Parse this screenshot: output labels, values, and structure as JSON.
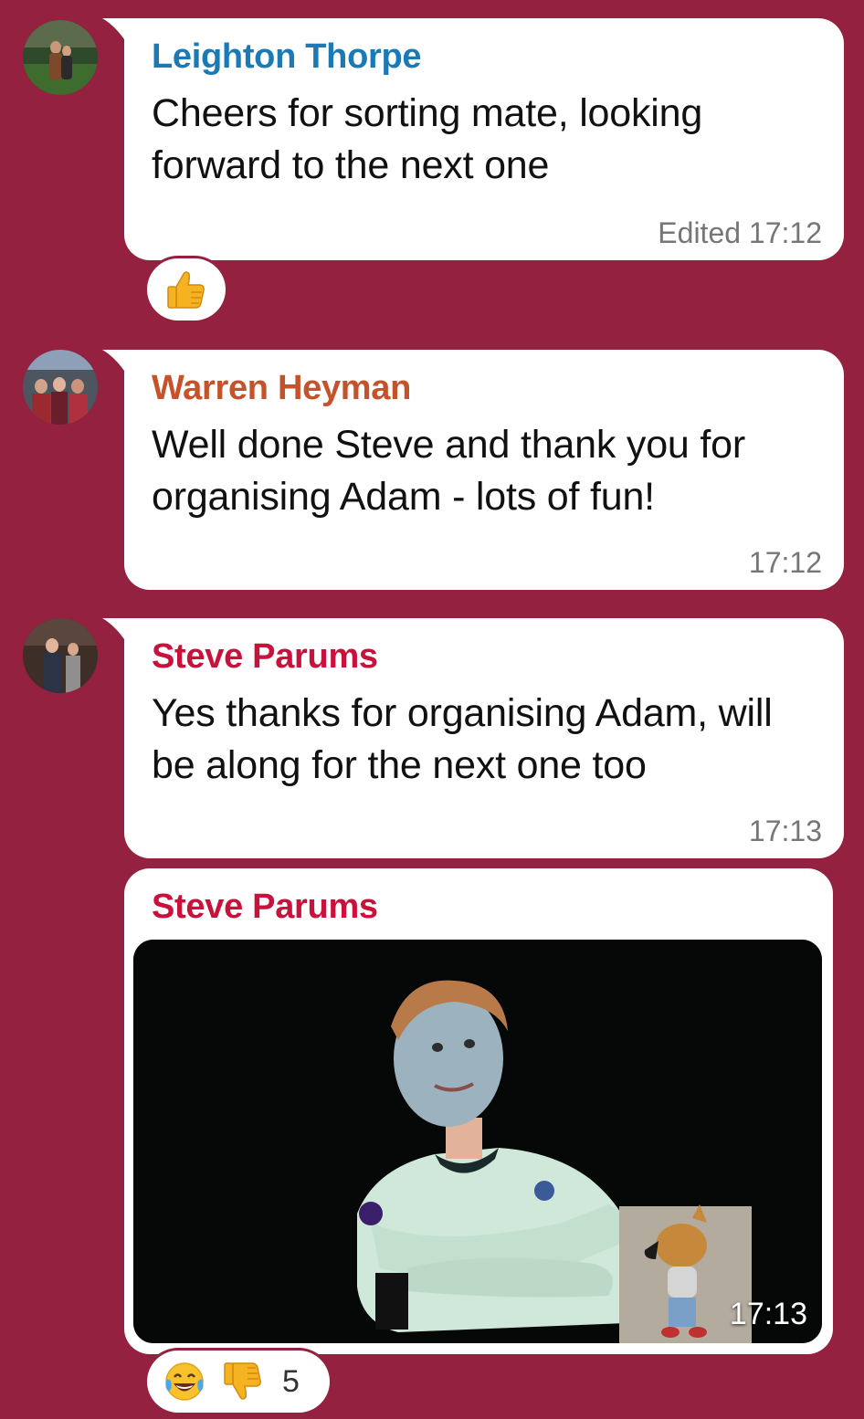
{
  "colors": {
    "background": "#93213f",
    "bubble": "#ffffff",
    "timestamp": "#767676"
  },
  "messages": [
    {
      "sender": "Leighton Thorpe",
      "sender_color": "#1b7ab5",
      "text": "Cheers for sorting mate, looking forward to the next one",
      "time": "Edited 17:12",
      "reactions": [
        {
          "icon": "thumbs-up-icon"
        }
      ]
    },
    {
      "sender": "Warren Heyman",
      "sender_color": "#c4522a",
      "text": "Well done Steve and thank you for organising Adam - lots of fun!",
      "time": "17:12"
    },
    {
      "sender": "Steve Parums",
      "sender_color": "#c8123c",
      "text": "Yes thanks for organising Adam, will be along for the next one too",
      "time": "17:13"
    },
    {
      "sender": "Steve Parums",
      "sender_color": "#c8123c",
      "media": "photo",
      "time": "17:13",
      "reactions": [
        {
          "icon": "laughing-tears-icon"
        },
        {
          "icon": "thumbs-down-icon"
        }
      ],
      "reaction_count": "5"
    }
  ]
}
